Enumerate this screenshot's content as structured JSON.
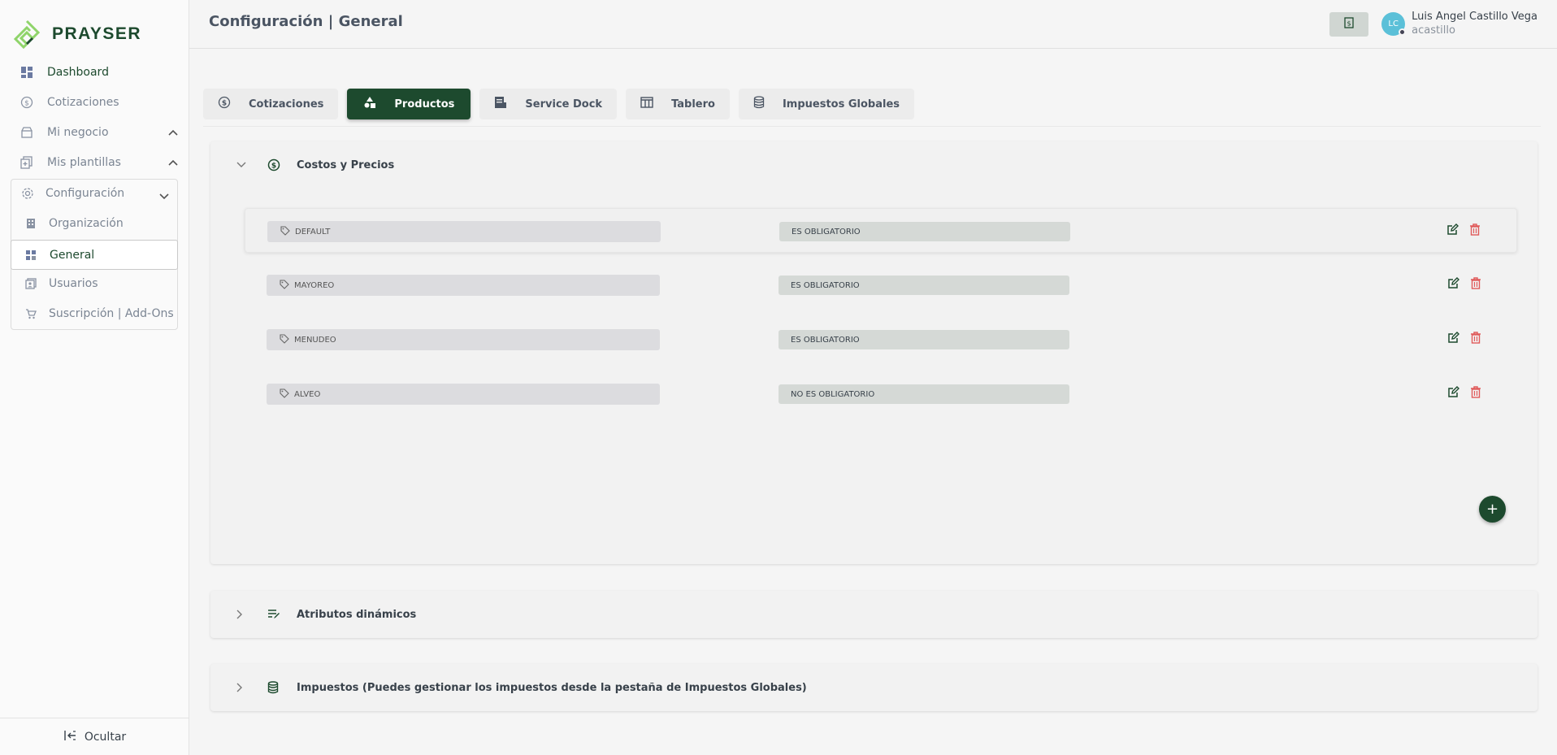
{
  "app": {
    "logo_text": "PRAYSER"
  },
  "sidebar": {
    "items": [
      {
        "label": "Dashboard",
        "icon": "dashboard-icon"
      },
      {
        "label": "Cotizaciones",
        "icon": "dollar-circle-icon"
      },
      {
        "label": "Mi negocio",
        "icon": "store-icon"
      },
      {
        "label": "Mis plantillas",
        "icon": "template-icon"
      },
      {
        "label": "Configuración",
        "icon": "gear-icon"
      }
    ],
    "config_sub": [
      {
        "label": "Organización",
        "icon": "building-icon"
      },
      {
        "label": "General",
        "icon": "widgets-icon"
      },
      {
        "label": "Usuarios",
        "icon": "users-icon"
      },
      {
        "label": "Suscripción | Add-Ons",
        "icon": "cart-icon"
      }
    ],
    "footer_label": "Ocultar"
  },
  "header": {
    "title": "Configuración | General",
    "user_initials": "LC",
    "user_name": "Luis Angel Castillo Vega",
    "user_handle": "acastillo"
  },
  "tabs": [
    {
      "label": "Cotizaciones"
    },
    {
      "label": "Productos"
    },
    {
      "label": "Service Dock"
    },
    {
      "label": "Tablero"
    },
    {
      "label": "Impuestos Globales"
    }
  ],
  "active_tab": "Productos",
  "panels": {
    "costos": {
      "title": "Costos y Precios",
      "rows": [
        {
          "name": "DEFAULT",
          "requirement": "ES OBLIGATORIO"
        },
        {
          "name": "MAYOREO",
          "requirement": "ES OBLIGATORIO"
        },
        {
          "name": "MENUDEO",
          "requirement": "ES OBLIGATORIO"
        },
        {
          "name": "ALVEO",
          "requirement": "NO ES OBLIGATORIO"
        }
      ],
      "add_label": "+"
    },
    "atributos": {
      "title": "Atributos dinámicos"
    },
    "impuestos": {
      "title": "Impuestos (Puedes gestionar los impuestos desde la pestaña de Impuestos Globales)"
    }
  },
  "colors": {
    "brand": "#1d4a2e",
    "delete": "#e05a5a",
    "avatar": "#5bc0d8"
  }
}
